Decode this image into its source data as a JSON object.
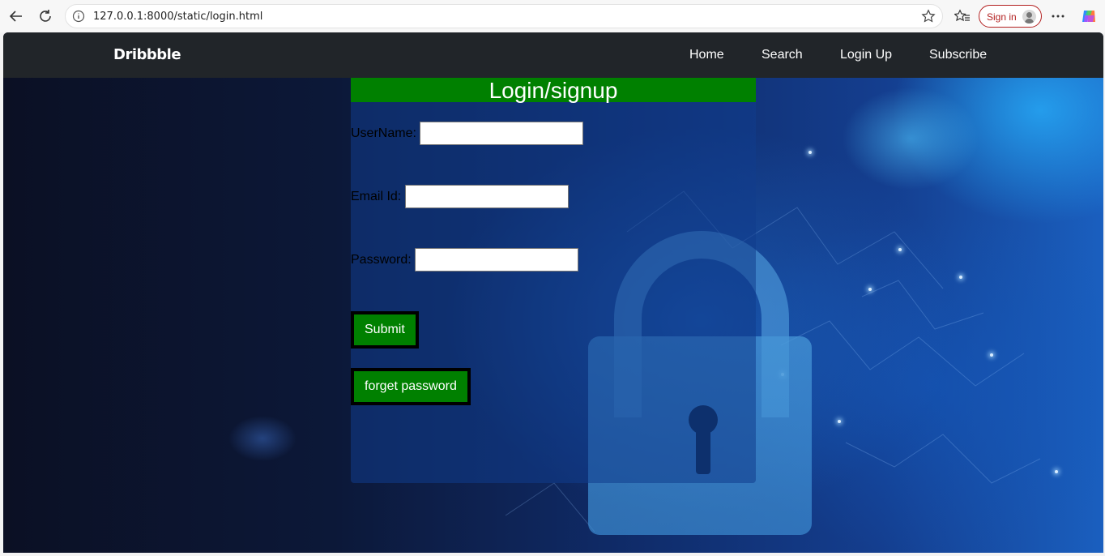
{
  "browser": {
    "url": "127.0.0.1:8000/static/login.html",
    "sign_in_label": "Sign in"
  },
  "navbar": {
    "brand": "Dribbble",
    "links": [
      "Home",
      "Search",
      "Login Up",
      "Subscribe"
    ]
  },
  "login": {
    "title": "Login/signup",
    "username_label": "UserName:",
    "email_label": "Email Id:",
    "password_label": "Password:",
    "username_value": "",
    "email_value": "",
    "password_value": "",
    "submit_label": "Submit",
    "forget_label": "forget password"
  },
  "colors": {
    "navbar_bg": "#212529",
    "accent_green": "#008000"
  },
  "icons": [
    "back-arrow-icon",
    "refresh-icon",
    "info-icon",
    "star-icon",
    "favorites-icon",
    "more-icon",
    "copilot-icon"
  ]
}
